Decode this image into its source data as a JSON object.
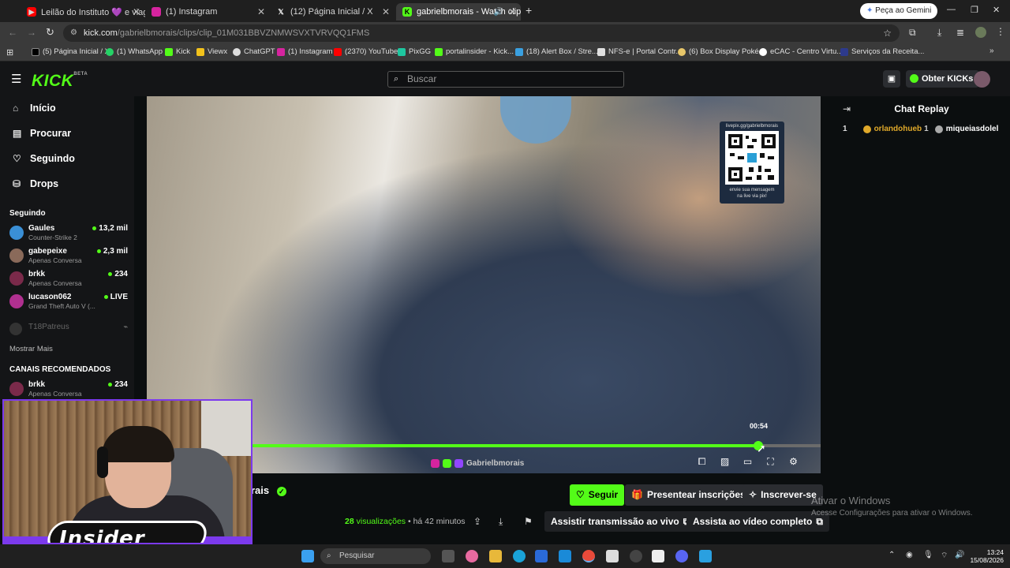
{
  "browser": {
    "tabs": [
      {
        "title": "Leilão do Instituto 💜 e viagem",
        "favicon": "youtube-icon",
        "color": "#ff0000"
      },
      {
        "title": "(1) Instagram",
        "favicon": "instagram-icon",
        "color": "#d6249f"
      },
      {
        "title": "(12) Página Inicial / X",
        "favicon": "x-icon",
        "color": "#ffffff"
      },
      {
        "title": "gabrielbmorais - Watch clip",
        "favicon": "kick-icon",
        "color": "#53fc18"
      }
    ],
    "gemini_button": "Peça ao Gemini",
    "url_host": "kick.com",
    "url_path": "/gabrielbmorais/clips/clip_01M031BBVZNMWSVXTVRVQQ1FMS",
    "bookmarks": [
      "(5) Página Inicial / X",
      "(1) WhatsApp",
      "Kick",
      "Viewx",
      "ChatGPT",
      "(1) Instagram",
      "(2370) YouTube",
      "PixGG",
      "portalinsider - Kick...",
      "(18) Alert Box / Stre...",
      "NFS-e | Portal Contr...",
      "(6) Box Display Poké...",
      "eCAC - Centro Virtu...",
      "Serviços da Receita..."
    ]
  },
  "kick": {
    "logo": "KICK",
    "logo_tag": "BETA",
    "search_placeholder": "Buscar",
    "get_kicks": "Obter KICKs",
    "nav": [
      {
        "label": "Início",
        "icon": "home-icon"
      },
      {
        "label": "Procurar",
        "icon": "browse-icon"
      },
      {
        "label": "Seguindo",
        "icon": "heart-icon"
      },
      {
        "label": "Drops",
        "icon": "drops-icon"
      }
    ],
    "following_header": "Seguindo",
    "following": [
      {
        "name": "Gaules",
        "game": "Counter-Strike 2",
        "viewers": "13,2 mil",
        "avatar_color": "#3a8fd6"
      },
      {
        "name": "gabepeixe",
        "game": "Apenas Conversa",
        "viewers": "2,3 mil",
        "avatar_color": "#8a6a5a"
      },
      {
        "name": "brkk",
        "game": "Apenas Conversa",
        "viewers": "234",
        "avatar_color": "#7a2a4a"
      },
      {
        "name": "lucason062",
        "game": "Grand Theft Auto V (...",
        "viewers": "LIVE",
        "avatar_color": "#b03090"
      }
    ],
    "offline_channel": "T18Patreus",
    "show_more": "Mostrar Mais",
    "recommended_header": "CANAIS RECOMENDADOS",
    "recommended": [
      {
        "name": "brkk",
        "game": "Apenas Conversa",
        "viewers": "234",
        "avatar_color": "#7a2a4a"
      }
    ],
    "chat_title": "Chat Replay",
    "chat_row": {
      "count": "1",
      "user1": "orlandohueb",
      "n1": "1",
      "user2": "miqueiasdolel"
    },
    "qr": {
      "top": "livepix.gg/gabrielbmorais",
      "bottom1": "envie sua mensagem",
      "bottom2": "na live via pix!"
    },
    "player": {
      "timecode": "00:54",
      "progress": 0.89,
      "watermark": "Gabrielbmorais"
    },
    "channel_name_partial": "rais",
    "follow": "Seguir",
    "gift": "Presentear inscrições",
    "subscribe": "Inscrever-se",
    "views_count": "28",
    "views_label": "visualizações",
    "time_ago": "há 42 minutos",
    "watch_live": "Assistir transmissão ao vivo",
    "watch_full": "Assista ao vídeo completo"
  },
  "windows": {
    "activate_title": "Ativar o Windows",
    "activate_sub": "Acesse Configurações para ativar o Windows.",
    "search": "Pesquisar",
    "time": "13:24",
    "date": "15/08/2026"
  },
  "overlay": {
    "brand": "Insider"
  }
}
